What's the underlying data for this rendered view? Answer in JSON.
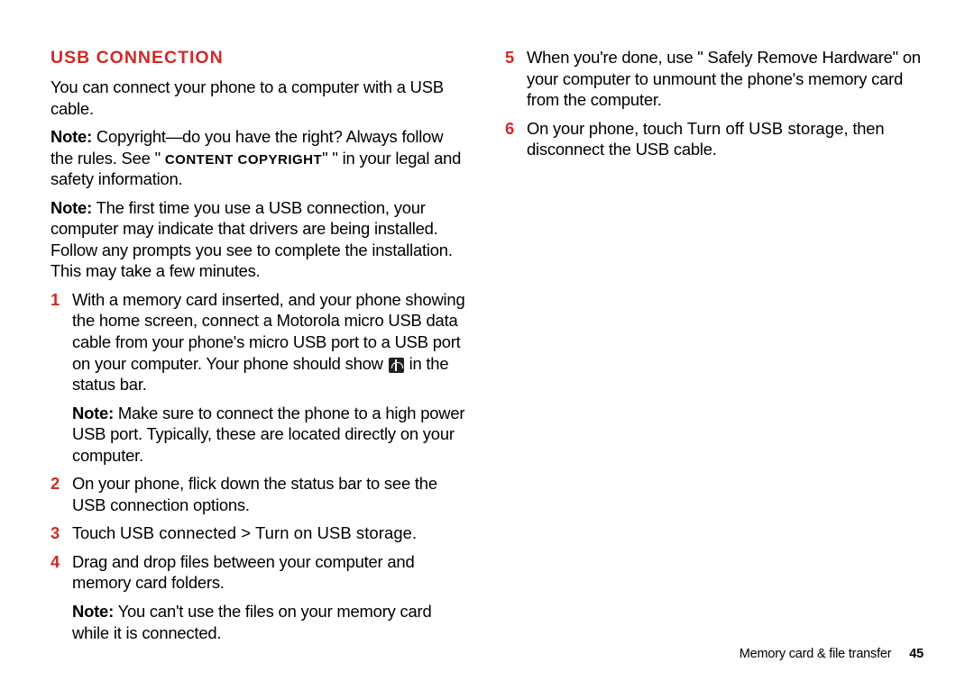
{
  "heading": "USB CONNECTION",
  "intro": "You can connect your phone to a computer with a USB cable.",
  "note1_label": "Note:",
  "note1_a": " Copyright—do you have the right? Always follow the rules. See \" ",
  "note1_sc": "CONTENT COPYRIGHT",
  "note1_b": "\" \" in your legal and safety information.",
  "note2_label": "Note:",
  "note2_body": " The first time you use a USB connection, your computer may indicate that drivers are being installed. Follow any prompts you see to complete the installation. This may take a few minutes.",
  "steps_left": [
    {
      "num": "1",
      "body_a": "With a memory card inserted, and your phone showing the home screen, connect a Motorola micro USB data cable from your phone's micro USB port to a USB port on your computer. Your phone should show ",
      "body_b": " in the status bar.",
      "subnote_label": "Note:",
      "subnote": " Make sure to connect the phone to a high power USB port. Typically, these are located directly on your computer.",
      "has_icon": true
    },
    {
      "num": "2",
      "body_a": "On your phone, flick down the status bar to see the USB connection options.",
      "body_b": ""
    },
    {
      "num": "3",
      "body_a": "Touch ",
      "cmd": "USB connected > Turn on USB storage",
      "body_b": "."
    },
    {
      "num": "4",
      "body_a": "Drag and drop files between your computer and memory card folders.",
      "body_b": "",
      "subnote_label": "Note:",
      "subnote": " You can't use the files on your memory card while it is connected."
    }
  ],
  "steps_right": [
    {
      "num": "5",
      "body_a": "When you're done, use \" Safely Remove Hardware\" on your computer to unmount the phone's memory card from the computer.",
      "body_b": ""
    },
    {
      "num": "6",
      "body_a": "On your phone, touch ",
      "cmd": "Turn off USB storage",
      "body_b": ", then disconnect the USB cable."
    }
  ],
  "footer_section": "Memory card & file transfer",
  "footer_page": "45"
}
